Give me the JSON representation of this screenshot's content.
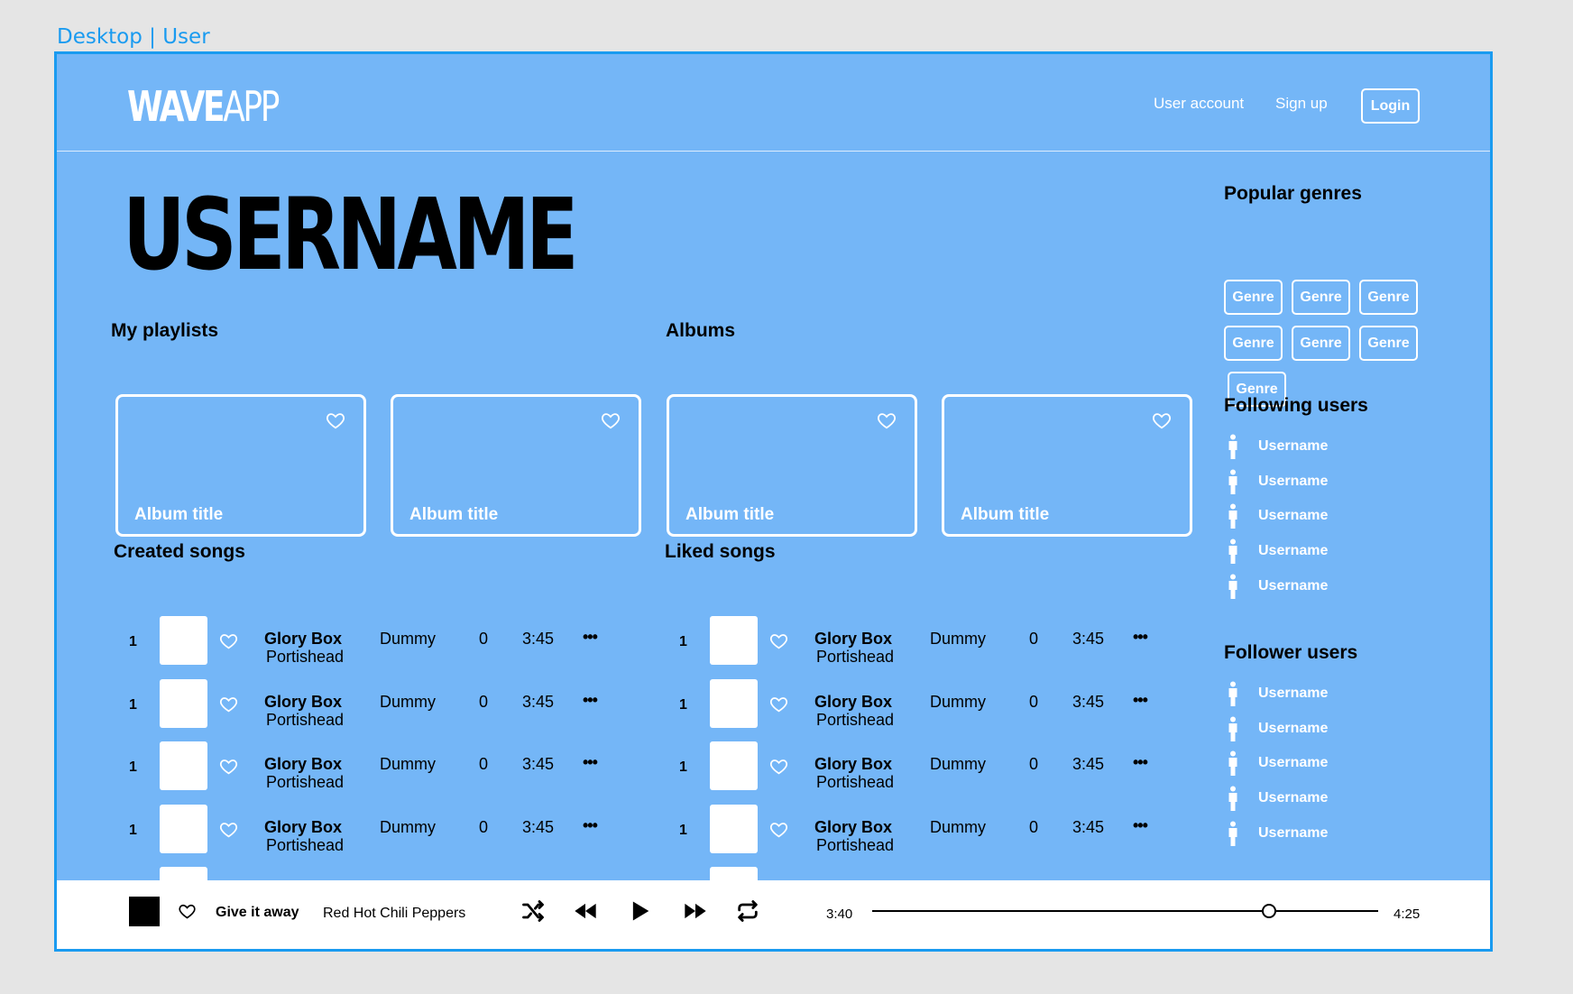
{
  "frame_label": "Desktop | User",
  "header": {
    "logo_bold": "WAVE",
    "logo_light": "APP",
    "nav": {
      "user_account": "User account",
      "sign_up": "Sign up",
      "login": "Login"
    }
  },
  "profile": {
    "username": "USERNAME"
  },
  "sections": {
    "my_playlists": "My playlists",
    "albums": "Albums",
    "created_songs": "Created songs",
    "liked_songs": "Liked songs",
    "popular_genres": "Popular genres",
    "following_users": "Following users",
    "follower_users": "Follower users"
  },
  "playlists": [
    {
      "title": "Album title"
    },
    {
      "title": "Album title"
    }
  ],
  "albums": [
    {
      "title": "Album title"
    },
    {
      "title": "Album title"
    }
  ],
  "created_songs": [
    {
      "num": "1",
      "title": "Glory Box",
      "artist": "Portishead",
      "album": "Dummy",
      "plays": "0",
      "duration": "3:45",
      "more": "•••"
    },
    {
      "num": "1",
      "title": "Glory Box",
      "artist": "Portishead",
      "album": "Dummy",
      "plays": "0",
      "duration": "3:45",
      "more": "•••"
    },
    {
      "num": "1",
      "title": "Glory Box",
      "artist": "Portishead",
      "album": "Dummy",
      "plays": "0",
      "duration": "3:45",
      "more": "•••"
    },
    {
      "num": "1",
      "title": "Glory Box",
      "artist": "Portishead",
      "album": "Dummy",
      "plays": "0",
      "duration": "3:45",
      "more": "•••"
    }
  ],
  "liked_songs": [
    {
      "num": "1",
      "title": "Glory Box",
      "artist": "Portishead",
      "album": "Dummy",
      "plays": "0",
      "duration": "3:45",
      "more": "•••"
    },
    {
      "num": "1",
      "title": "Glory Box",
      "artist": "Portishead",
      "album": "Dummy",
      "plays": "0",
      "duration": "3:45",
      "more": "•••"
    },
    {
      "num": "1",
      "title": "Glory Box",
      "artist": "Portishead",
      "album": "Dummy",
      "plays": "0",
      "duration": "3:45",
      "more": "•••"
    },
    {
      "num": "1",
      "title": "Glory Box",
      "artist": "Portishead",
      "album": "Dummy",
      "plays": "0",
      "duration": "3:45",
      "more": "•••"
    }
  ],
  "genres": [
    "Genre",
    "Genre",
    "Genre",
    "Genre",
    "Genre",
    "Genre",
    "Genre"
  ],
  "following_users": [
    "Username",
    "Username",
    "Username",
    "Username",
    "Username"
  ],
  "follower_users": [
    "Username",
    "Username",
    "Username",
    "Username",
    "Username"
  ],
  "player": {
    "title": "Give it away",
    "artist": "Red Hot Chili Peppers",
    "elapsed": "3:40",
    "total": "4:25",
    "progress": 0.785
  },
  "colors": {
    "background": "#74b6f7",
    "frame_border": "#1a9bf0",
    "player_bg": "#ffffff"
  }
}
